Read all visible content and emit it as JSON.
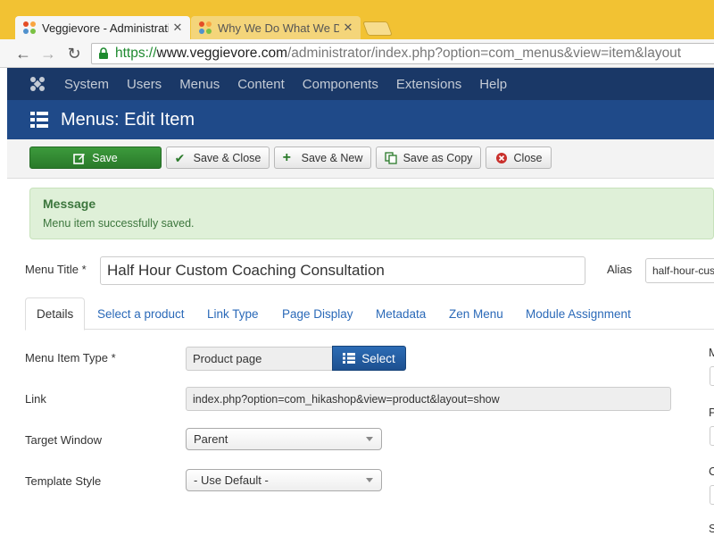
{
  "browser": {
    "tabs": [
      {
        "title": "Veggievore - Administrati",
        "active": true
      },
      {
        "title": "Why We Do What We Do",
        "active": false
      }
    ],
    "url": {
      "scheme": "https://",
      "host": "www.veggievore.com",
      "path": "/administrator/index.php?option=com_menus&view=item&layout"
    }
  },
  "admin_nav": {
    "items": [
      "System",
      "Users",
      "Menus",
      "Content",
      "Components",
      "Extensions",
      "Help"
    ]
  },
  "header": {
    "title": "Menus: Edit Item"
  },
  "toolbar": {
    "save": "Save",
    "save_close": "Save & Close",
    "save_new": "Save & New",
    "save_copy": "Save as Copy",
    "close": "Close"
  },
  "message": {
    "heading": "Message",
    "text": "Menu item successfully saved."
  },
  "form": {
    "menu_title_label": "Menu Title *",
    "menu_title_value": "Half Hour Custom Coaching Consultation",
    "alias_label": "Alias",
    "alias_value": "half-hour-cus",
    "tabs": [
      "Details",
      "Select a product",
      "Link Type",
      "Page Display",
      "Metadata",
      "Zen Menu",
      "Module Assignment"
    ],
    "menu_item_type_label": "Menu Item Type *",
    "menu_item_type_value": "Product page",
    "select_button": "Select",
    "link_label": "Link",
    "link_value": "index.php?option=com_hikashop&view=product&layout=show",
    "target_window_label": "Target Window",
    "target_window_value": "Parent",
    "template_style_label": "Template Style",
    "template_style_value": "- Use Default -",
    "right_labels": [
      "M",
      "P",
      "C",
      "S"
    ]
  },
  "colors": {
    "chrome": "#f2c233",
    "admin_nav": "#1a3867",
    "header": "#1f4a89",
    "save": "#2a7a2a",
    "message_bg": "#dff0d8",
    "select_btn": "#1d5090"
  }
}
